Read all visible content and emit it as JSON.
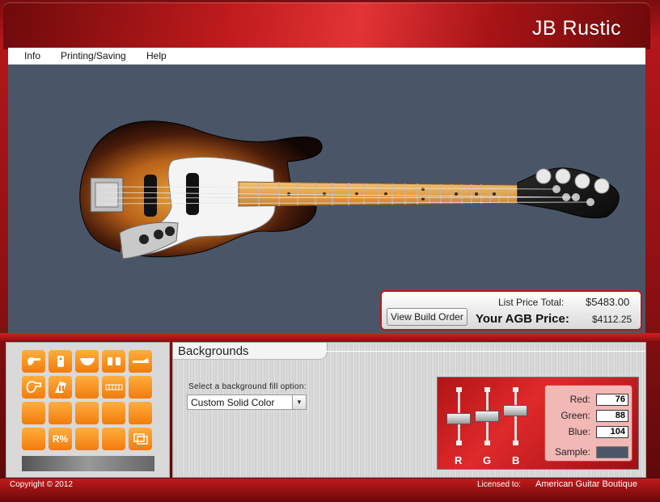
{
  "header": {
    "title": "JB Rustic"
  },
  "menu": {
    "items": [
      "Info",
      "Printing/Saving",
      "Help"
    ]
  },
  "pricing": {
    "view_build_order_label": "View Build Order",
    "list_label": "List Price Total:",
    "list_value": "$5483.00",
    "agb_label": "Your AGB Price:",
    "agb_value": "$4112.25"
  },
  "toolbox": {
    "tools": [
      {
        "icon": "guitar-body-icon"
      },
      {
        "icon": "pickguard-icon"
      },
      {
        "icon": "pickup-icon"
      },
      {
        "icon": "pickups-pair-icon"
      },
      {
        "icon": "neck-icon"
      },
      {
        "icon": "body-outline-icon"
      },
      {
        "icon": "tuners-icon"
      },
      {
        "icon": "blank-tool-icon"
      },
      {
        "icon": "fret-icon"
      },
      {
        "icon": "blank-tool-icon"
      },
      {
        "icon": "blank-tool-icon"
      },
      {
        "icon": "blank-tool-icon"
      },
      {
        "icon": "blank-tool-icon"
      },
      {
        "icon": "blank-tool-icon"
      },
      {
        "icon": "blank-tool-icon"
      },
      {
        "icon": "blank-tool-icon"
      },
      {
        "icon": "text-tool-icon",
        "label": "R%"
      },
      {
        "icon": "blank-tool-icon"
      },
      {
        "icon": "blank-tool-icon"
      },
      {
        "icon": "backgrounds-icon"
      }
    ]
  },
  "panel": {
    "tab_label": "Backgrounds",
    "select_label": "Select a background fill option:",
    "select_value": "Custom Solid Color",
    "select_arrow": "▼"
  },
  "color": {
    "slider_labels": [
      "R",
      "G",
      "B"
    ],
    "levels": [
      0.56,
      0.5,
      0.38
    ],
    "red_label": "Red:",
    "red_value": "76",
    "green_label": "Green:",
    "green_value": "88",
    "blue_label": "Blue:",
    "blue_value": "104",
    "sample_label": "Sample:",
    "sample_color": "#4c5868"
  },
  "footer": {
    "copyright": "Copyright © 2012",
    "licensed_label": "Licensed to:",
    "licensee": "American Guitar Boutique"
  },
  "colors": {
    "brand_red": "#c01b1d",
    "stage_bg": "#4a5668",
    "tool_orange": "#f5901f"
  }
}
